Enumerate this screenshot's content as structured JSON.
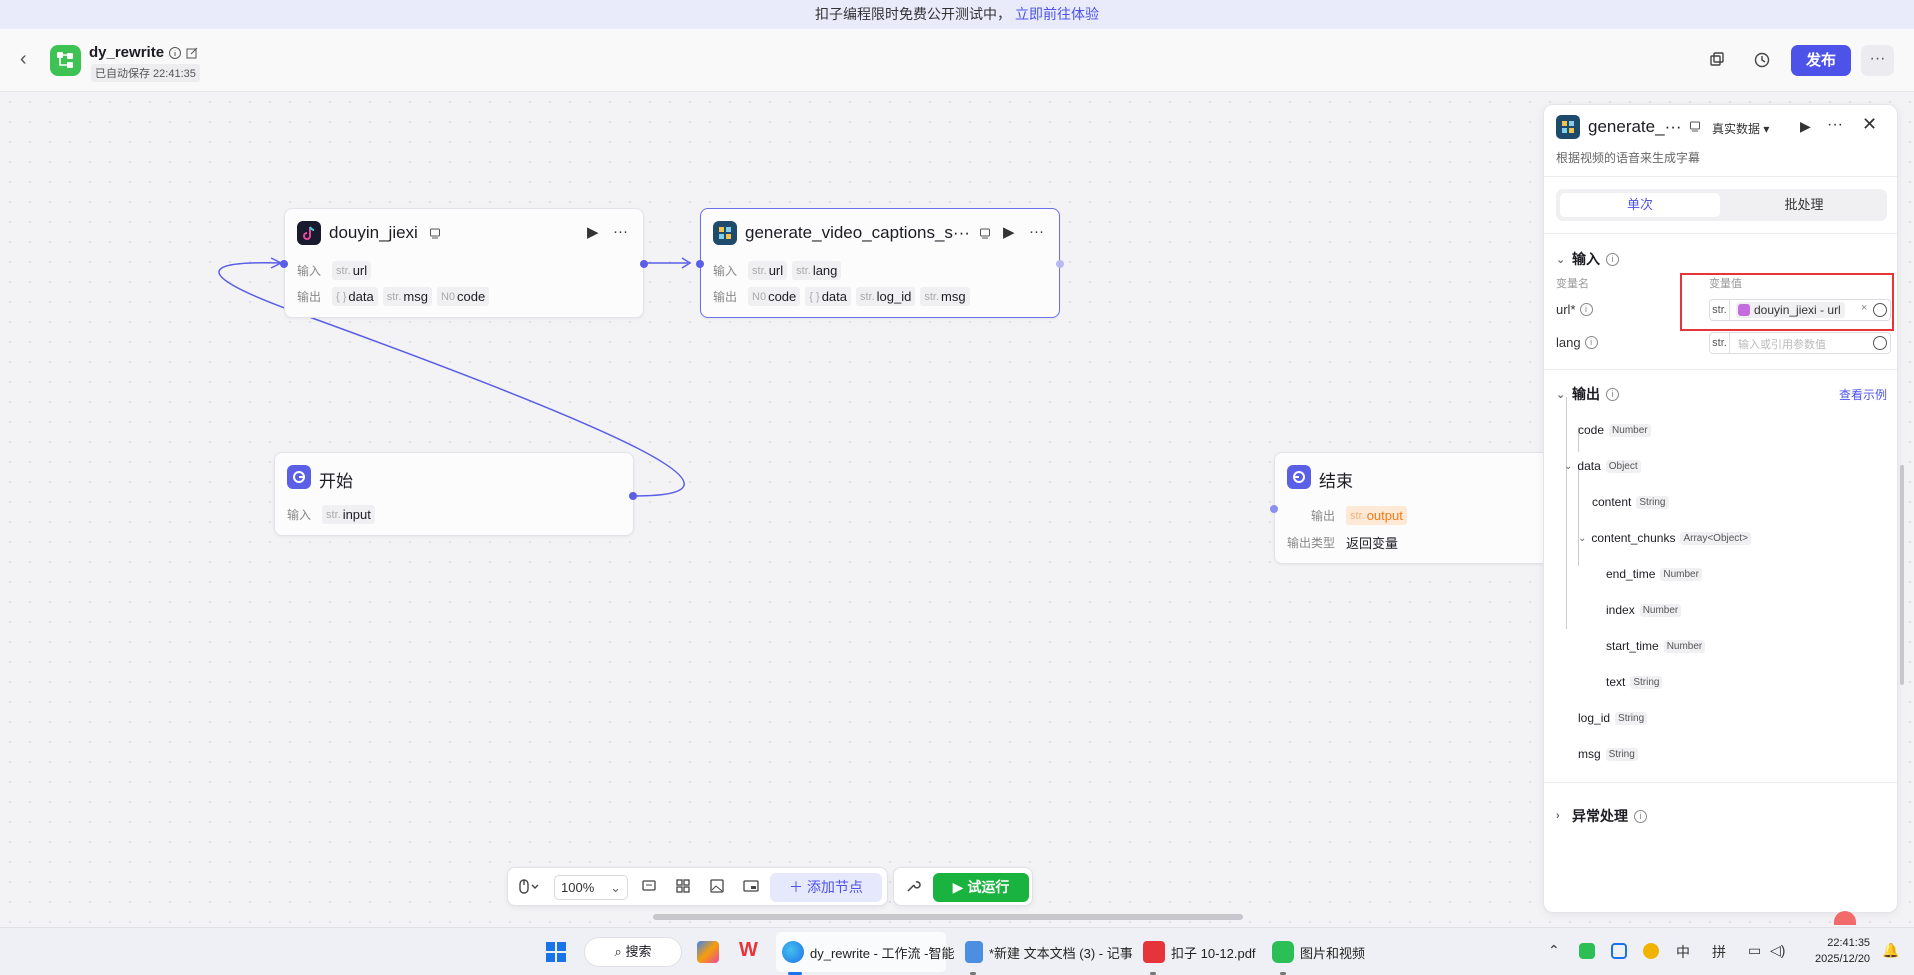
{
  "banner": {
    "text": "扣子编程限时免费公开测试中，",
    "link": "立即前往体验"
  },
  "header": {
    "title": "dy_rewrite",
    "autosave": "已自动保存 22:41:35",
    "publish_label": "发布",
    "more_label": "···"
  },
  "nodes": {
    "douyin": {
      "title": "douyin_jiexi",
      "input_label": "输入",
      "output_label": "输出",
      "inputs": [
        {
          "type": "str.",
          "name": "url"
        }
      ],
      "outputs": [
        {
          "type": "{ }",
          "name": "data"
        },
        {
          "type": "str.",
          "name": "msg"
        },
        {
          "type": "N0",
          "name": "code"
        }
      ]
    },
    "captions": {
      "title": "generate_video_captions_s···",
      "input_label": "输入",
      "output_label": "输出",
      "inputs": [
        {
          "type": "str.",
          "name": "url"
        },
        {
          "type": "str.",
          "name": "lang"
        }
      ],
      "outputs": [
        {
          "type": "N0",
          "name": "code"
        },
        {
          "type": "{ }",
          "name": "data"
        },
        {
          "type": "str.",
          "name": "log_id"
        },
        {
          "type": "str.",
          "name": "msg"
        }
      ]
    },
    "start": {
      "title": "开始",
      "input_label": "输入",
      "inputs": [
        {
          "type": "str.",
          "name": "input"
        }
      ]
    },
    "end": {
      "title": "结束",
      "output_label": "输出",
      "output_type_label": "输出类型",
      "output": {
        "type": "str.",
        "name": "output"
      },
      "output_type": "返回变量"
    }
  },
  "toolbar": {
    "zoom": "100%",
    "add_node": "添加节点",
    "trial_run": "试运行"
  },
  "panel": {
    "title": "generate_···",
    "data_mode": "真实数据",
    "description": "根据视频的语音来生成字幕",
    "tab_single": "单次",
    "tab_batch": "批处理",
    "input_section": "输入",
    "col_name": "变量名",
    "col_value": "变量值",
    "params": [
      {
        "name": "url*",
        "type": "str.",
        "ref_node": "douyin_jiexi",
        "ref_sep": " - ",
        "ref_var": "url"
      },
      {
        "name": "lang",
        "type": "str.",
        "placeholder": "输入或引用参数值"
      }
    ],
    "output_section": "输出",
    "view_example": "查看示例",
    "outputs": [
      {
        "name": "code",
        "type": "Number"
      },
      {
        "name": "data",
        "type": "Object"
      },
      {
        "name": "content",
        "type": "String"
      },
      {
        "name": "content_chunks",
        "type": "Array<Object>"
      },
      {
        "name": "end_time",
        "type": "Number"
      },
      {
        "name": "index",
        "type": "Number"
      },
      {
        "name": "start_time",
        "type": "Number"
      },
      {
        "name": "text",
        "type": "String"
      },
      {
        "name": "log_id",
        "type": "String"
      },
      {
        "name": "msg",
        "type": "String"
      }
    ],
    "error_section": "异常处理"
  },
  "taskbar": {
    "search": "搜索",
    "apps": [
      {
        "label": "dy_rewrite - 工作流 -智能"
      },
      {
        "label": "*新建 文本文档 (3) - 记事"
      },
      {
        "label": "扣子 10-12.pdf"
      },
      {
        "label": "图片和视频"
      }
    ],
    "ime_lang": "中",
    "ime_mode": "拼",
    "time": "22:41:35",
    "date": "2025/12/20"
  },
  "colors": {
    "accent": "#4d53e8",
    "run_green": "#1bb33f",
    "highlight_red": "#e5343a"
  }
}
